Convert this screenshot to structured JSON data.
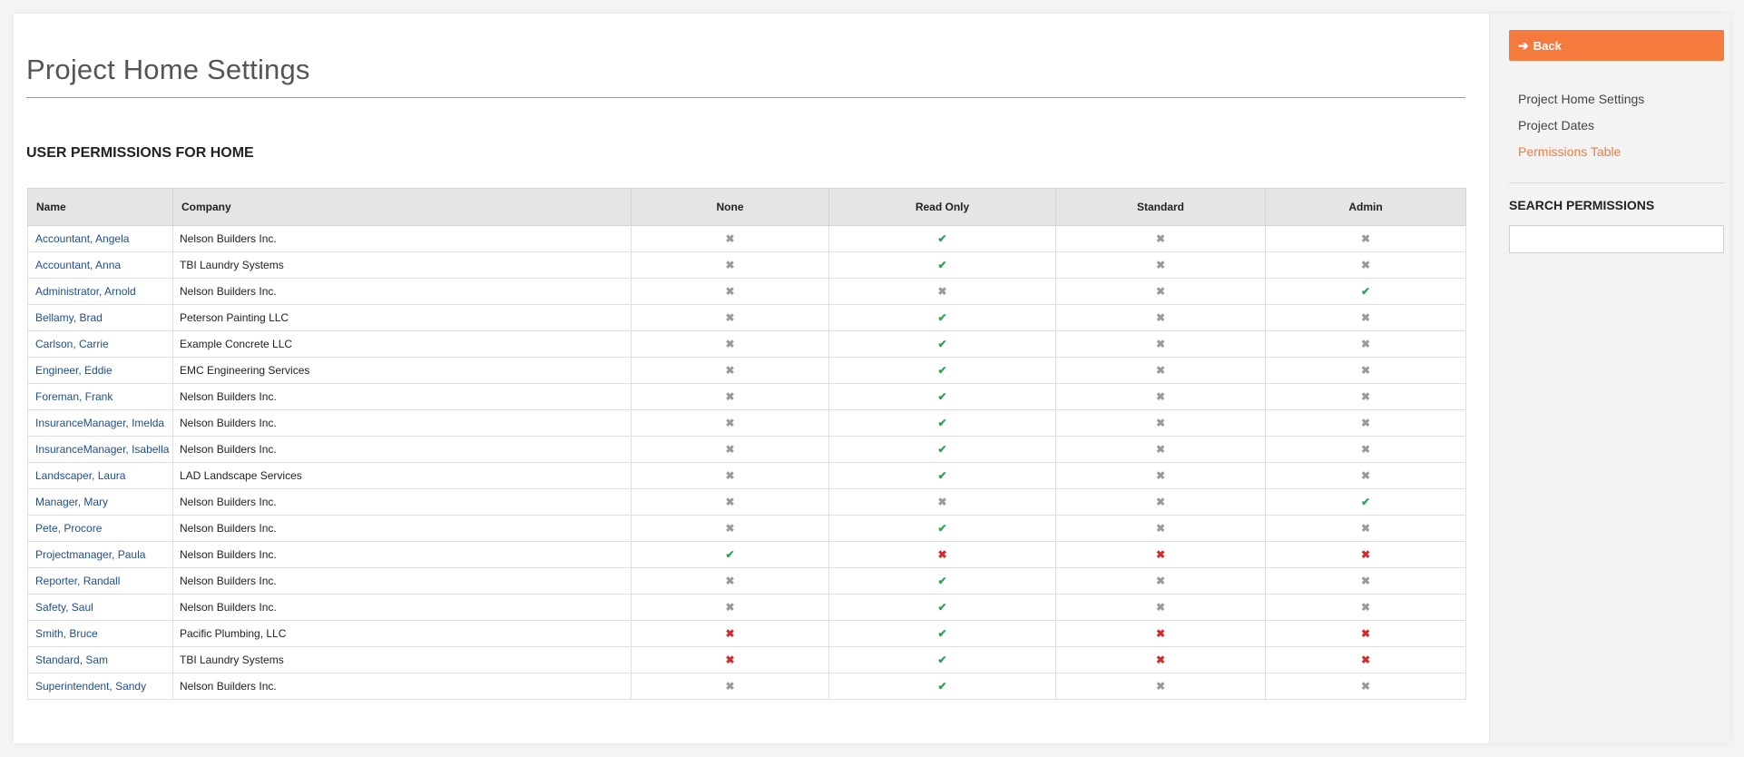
{
  "page": {
    "title": "Project Home Settings",
    "section_heading": "USER PERMISSIONS FOR HOME"
  },
  "table": {
    "headers": {
      "name": "Name",
      "company": "Company",
      "none": "None",
      "read_only": "Read Only",
      "standard": "Standard",
      "admin": "Admin"
    },
    "rows": [
      {
        "name": "Accountant, Angela",
        "company": "Nelson Builders Inc.",
        "none": "x",
        "read_only": "check",
        "standard": "x",
        "admin": "x"
      },
      {
        "name": "Accountant, Anna",
        "company": "TBI Laundry Systems",
        "none": "x",
        "read_only": "check",
        "standard": "x",
        "admin": "x"
      },
      {
        "name": "Administrator, Arnold",
        "company": "Nelson Builders Inc.",
        "none": "x",
        "read_only": "x",
        "standard": "x",
        "admin": "check"
      },
      {
        "name": "Bellamy, Brad",
        "company": "Peterson Painting LLC",
        "none": "x",
        "read_only": "check",
        "standard": "x",
        "admin": "x"
      },
      {
        "name": "Carlson, Carrie",
        "company": "Example Concrete LLC",
        "none": "x",
        "read_only": "check",
        "standard": "x",
        "admin": "x"
      },
      {
        "name": "Engineer, Eddie",
        "company": "EMC Engineering Services",
        "none": "x",
        "read_only": "check",
        "standard": "x",
        "admin": "x"
      },
      {
        "name": "Foreman, Frank",
        "company": "Nelson Builders Inc.",
        "none": "x",
        "read_only": "check",
        "standard": "x",
        "admin": "x"
      },
      {
        "name": "InsuranceManager, Imelda",
        "company": "Nelson Builders Inc.",
        "none": "x",
        "read_only": "check",
        "standard": "x",
        "admin": "x"
      },
      {
        "name": "InsuranceManager, Isabella",
        "company": "Nelson Builders Inc.",
        "none": "x",
        "read_only": "check",
        "standard": "x",
        "admin": "x"
      },
      {
        "name": "Landscaper, Laura",
        "company": "LAD Landscape Services",
        "none": "x",
        "read_only": "check",
        "standard": "x",
        "admin": "x"
      },
      {
        "name": "Manager, Mary",
        "company": "Nelson Builders Inc.",
        "none": "x",
        "read_only": "x",
        "standard": "x",
        "admin": "check"
      },
      {
        "name": "Pete, Procore",
        "company": "Nelson Builders Inc.",
        "none": "x",
        "read_only": "check",
        "standard": "x",
        "admin": "x"
      },
      {
        "name": "Projectmanager, Paula",
        "company": "Nelson Builders Inc.",
        "none": "check",
        "read_only": "x-red",
        "standard": "x-red",
        "admin": "x-red"
      },
      {
        "name": "Reporter, Randall",
        "company": "Nelson Builders Inc.",
        "none": "x",
        "read_only": "check",
        "standard": "x",
        "admin": "x"
      },
      {
        "name": "Safety, Saul",
        "company": "Nelson Builders Inc.",
        "none": "x",
        "read_only": "check",
        "standard": "x",
        "admin": "x"
      },
      {
        "name": "Smith, Bruce",
        "company": "Pacific Plumbing, LLC",
        "none": "x-red",
        "read_only": "check",
        "standard": "x-red",
        "admin": "x-red"
      },
      {
        "name": "Standard, Sam",
        "company": "TBI Laundry Systems",
        "none": "x-red",
        "read_only": "check",
        "standard": "x-red",
        "admin": "x-red"
      },
      {
        "name": "Superintendent, Sandy",
        "company": "Nelson Builders Inc.",
        "none": "x",
        "read_only": "check",
        "standard": "x",
        "admin": "x"
      }
    ]
  },
  "sidebar": {
    "back_label": "Back",
    "back_icon": "arrow-left-icon",
    "nav": [
      {
        "label": "Project Home Settings",
        "active": false
      },
      {
        "label": "Project Dates",
        "active": false
      },
      {
        "label": "Permissions Table",
        "active": true
      }
    ],
    "search_heading": "SEARCH PERMISSIONS",
    "search_value": "",
    "search_placeholder": ""
  },
  "colors": {
    "accent": "#f47a3d",
    "link": "#1f4e8c",
    "check": "#2fa24f",
    "x_gray": "#9a9a9a",
    "x_red": "#d32b2b"
  }
}
